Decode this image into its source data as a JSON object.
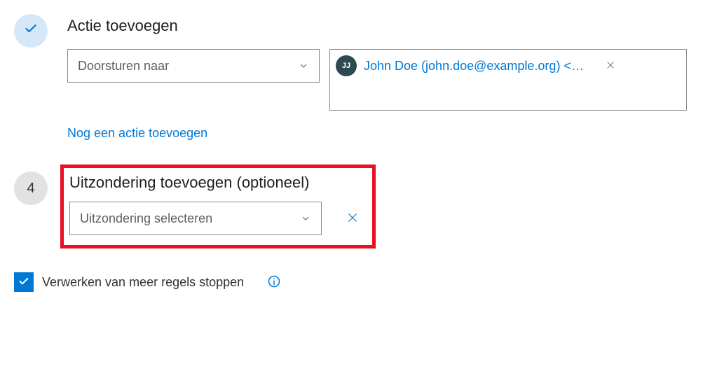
{
  "step_action": {
    "title": "Actie toevoegen",
    "dropdown_value": "Doorsturen naar",
    "add_another": "Nog een actie toevoegen",
    "person": {
      "initials": "JJ",
      "display": "John Doe (john.doe@example.org) <…"
    }
  },
  "step_exception": {
    "number": "4",
    "title": "Uitzondering toevoegen (optioneel)",
    "dropdown_value": "Uitzondering selecteren"
  },
  "stop_processing": {
    "label": "Verwerken van meer regels stoppen"
  }
}
